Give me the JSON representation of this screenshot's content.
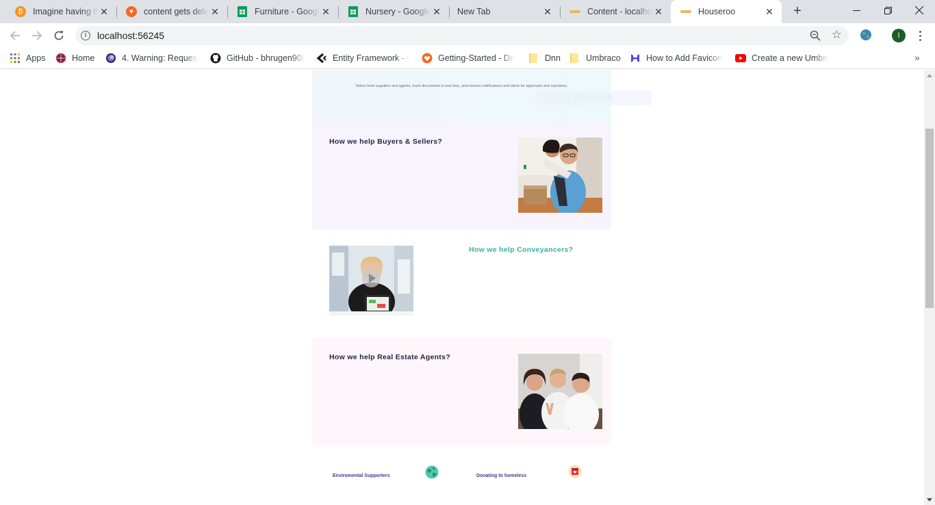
{
  "browser": {
    "tabs": [
      {
        "title": "Imagine having th",
        "favicon": "bitcoin-icon",
        "color": "#f7931a"
      },
      {
        "title": "content gets delet",
        "favicon": "umbraco-heart-icon",
        "color": "#f26a21"
      },
      {
        "title": "Furniture - Google",
        "favicon": "sheets-icon",
        "color": "#0f9d58"
      },
      {
        "title": "Nursery - Google S",
        "favicon": "sheets-icon",
        "color": "#0f9d58"
      },
      {
        "title": "New Tab",
        "favicon": "",
        "color": ""
      },
      {
        "title": "Content - localhos",
        "favicon": "houseroo-logo-icon",
        "color": "#f0b35a"
      },
      {
        "title": "Houseroo",
        "favicon": "houseroo-logo-icon",
        "color": "#f0b35a",
        "active": true
      }
    ],
    "address": "localhost:56245",
    "profile_initial": "I",
    "bookmarks": [
      {
        "label": "Apps",
        "icon": "apps-grid-icon"
      },
      {
        "label": "Home",
        "icon": "home-flag-icon"
      },
      {
        "label": "4. Warning: Requeste",
        "icon": "eclipse-icon"
      },
      {
        "label": "GitHub - bhrugen90/",
        "icon": "github-icon"
      },
      {
        "label": "Entity Framework - C",
        "icon": "chevron-logo-icon"
      },
      {
        "label": "Getting-Started - Doc",
        "icon": "umbraco-heart-icon"
      },
      {
        "label": "Dnn",
        "icon": "folder-icon"
      },
      {
        "label": "Umbraco",
        "icon": "folder-icon"
      },
      {
        "label": "How to Add Favicon t",
        "icon": "h-logo-icon"
      },
      {
        "label": "Create a new Umbrac",
        "icon": "youtube-icon"
      }
    ]
  },
  "page": {
    "hero_text": "Select from suppliers and agents, track documents in real time, and receive notifications and alerts for approvals and rejections.",
    "snip_ghost": "Window Snip",
    "sections": {
      "buyers": {
        "title": "How we help Buyers & Sellers?"
      },
      "conveyancers": {
        "title": "How we help Conveyancers?"
      },
      "agents": {
        "title": "How we help Real Estate Agents?"
      }
    },
    "footer": {
      "environment": "Enviromental Supporters",
      "homeless": "Donating to homeless"
    },
    "colors": {
      "heading_dark": "#1f2340",
      "heading_teal": "#36b2a4",
      "footer_text": "#3d3f86"
    }
  }
}
